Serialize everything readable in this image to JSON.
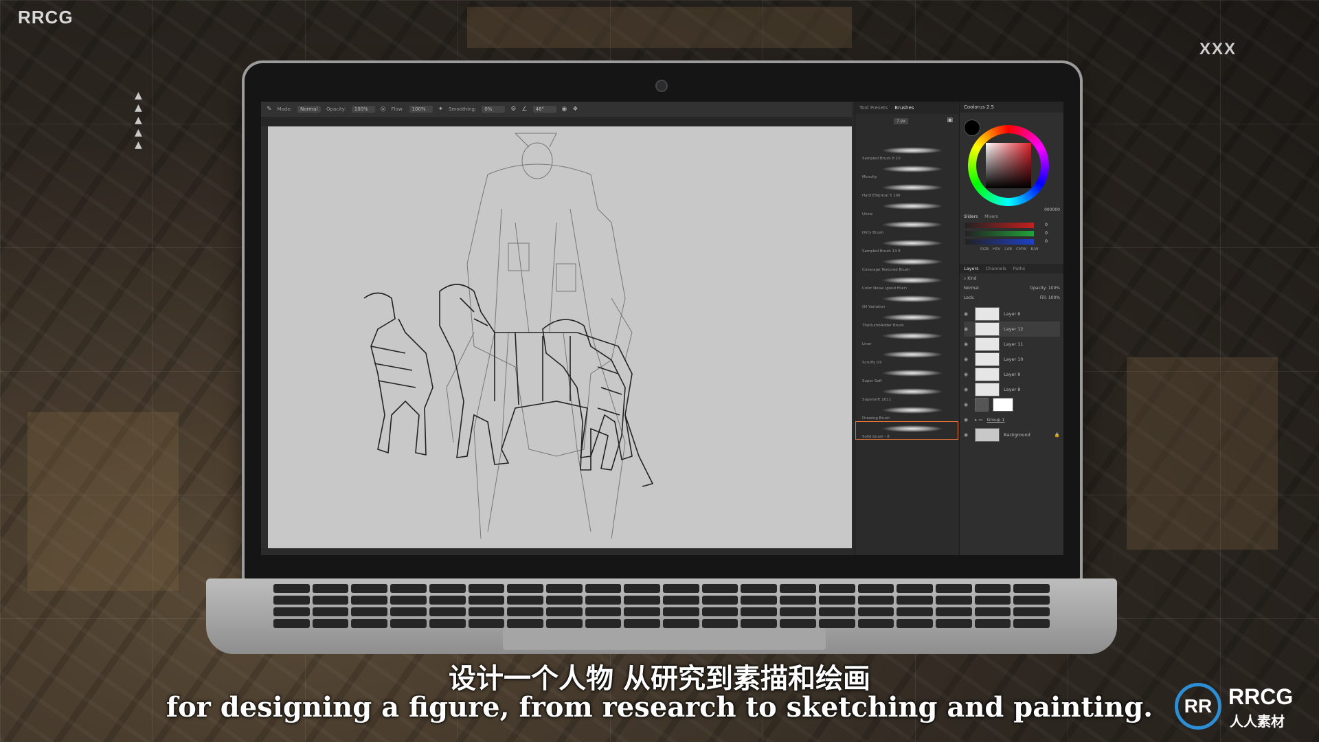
{
  "watermark": {
    "corner_logo": "RRCG",
    "top_right_mark": "XXX"
  },
  "toolbar": {
    "mode_label": "Mode:",
    "mode_value": "Normal",
    "opacity_label": "Opacity:",
    "opacity_value": "100%",
    "flow_label": "Flow:",
    "flow_value": "100%",
    "smoothing_label": "Smoothing:",
    "smoothing_value": "0%",
    "angle_value": "46°"
  },
  "brush_panel": {
    "tabs": [
      "Tool Presets",
      "Brushes"
    ],
    "active_tab": "Brushes",
    "size_value": "7 px",
    "brushes": [
      "Sampled Brush 8 10",
      "Mcnulty",
      "Hard Elliptical 5 100",
      "Unsie",
      "Dirty Brush",
      "Sampled Brush 14 8",
      "Coverage Textured Brush",
      "Color Noise (good filler)",
      "Oil Variation",
      "TheDumbAdder Brush",
      "Liner",
      "Scruffy Oil",
      "Super Soft",
      "Supersoft 1011",
      "Drawing Brush",
      "Solid brush - 8"
    ],
    "selected_brush": "Solid brush - 8"
  },
  "color_panel": {
    "title": "Coolorus 2.5",
    "hex_value": "000000",
    "slider_tabs": [
      "Sliders",
      "Mixers"
    ],
    "model_tabs": [
      "RGB",
      "HSV",
      "LAB",
      "CMYK",
      "B/W"
    ],
    "slider_values": [
      "0",
      "0",
      "0"
    ],
    "colors": {
      "wheel_accent": "#e0212a",
      "red_slider": "#c42020",
      "green_slider": "#21a33a",
      "blue_slider": "#2040c8"
    }
  },
  "layers_panel": {
    "tabs": [
      "Layers",
      "Channels",
      "Paths"
    ],
    "kind_label": "Kind",
    "blend_mode": "Normal",
    "opacity_label": "Opacity:",
    "opacity_value": "100%",
    "lock_label": "Lock:",
    "fill_label": "Fill:",
    "fill_value": "100%",
    "layers": [
      "Layer 8",
      "Layer 12",
      "Layer 11",
      "Layer 10",
      "Layer 9",
      "Layer 8",
      "",
      "Group 1",
      "Background"
    ],
    "selected_layer": "Layer 12"
  },
  "subtitles": {
    "chinese": "设计一个人物 从研究到素描和绘画",
    "english": "for designing a figure, from research to sketching and painting."
  },
  "brand": {
    "name": "RRCG",
    "sub": "人人素材",
    "badge": "RR"
  }
}
